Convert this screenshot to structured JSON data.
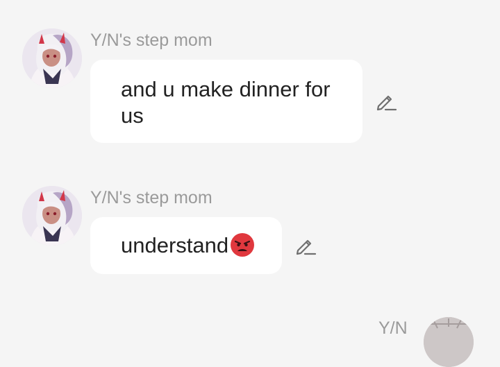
{
  "messages": [
    {
      "sender": "Y/N's step mom",
      "avatar_icon": "character-avatar-icon",
      "text": "and u make dinner for us",
      "edit_icon": "pencil-icon"
    },
    {
      "sender": "Y/N's step mom",
      "avatar_icon": "character-avatar-icon",
      "text": "understand",
      "emoji": "angry-face-emoji",
      "edit_icon": "pencil-icon"
    }
  ],
  "partial_message": {
    "sender": "Y/N"
  },
  "colors": {
    "background": "#f5f5f5",
    "bubble": "#ffffff",
    "sender_text": "#9a9a9a",
    "message_text": "#222222",
    "emoji_red": "#e0383e"
  }
}
